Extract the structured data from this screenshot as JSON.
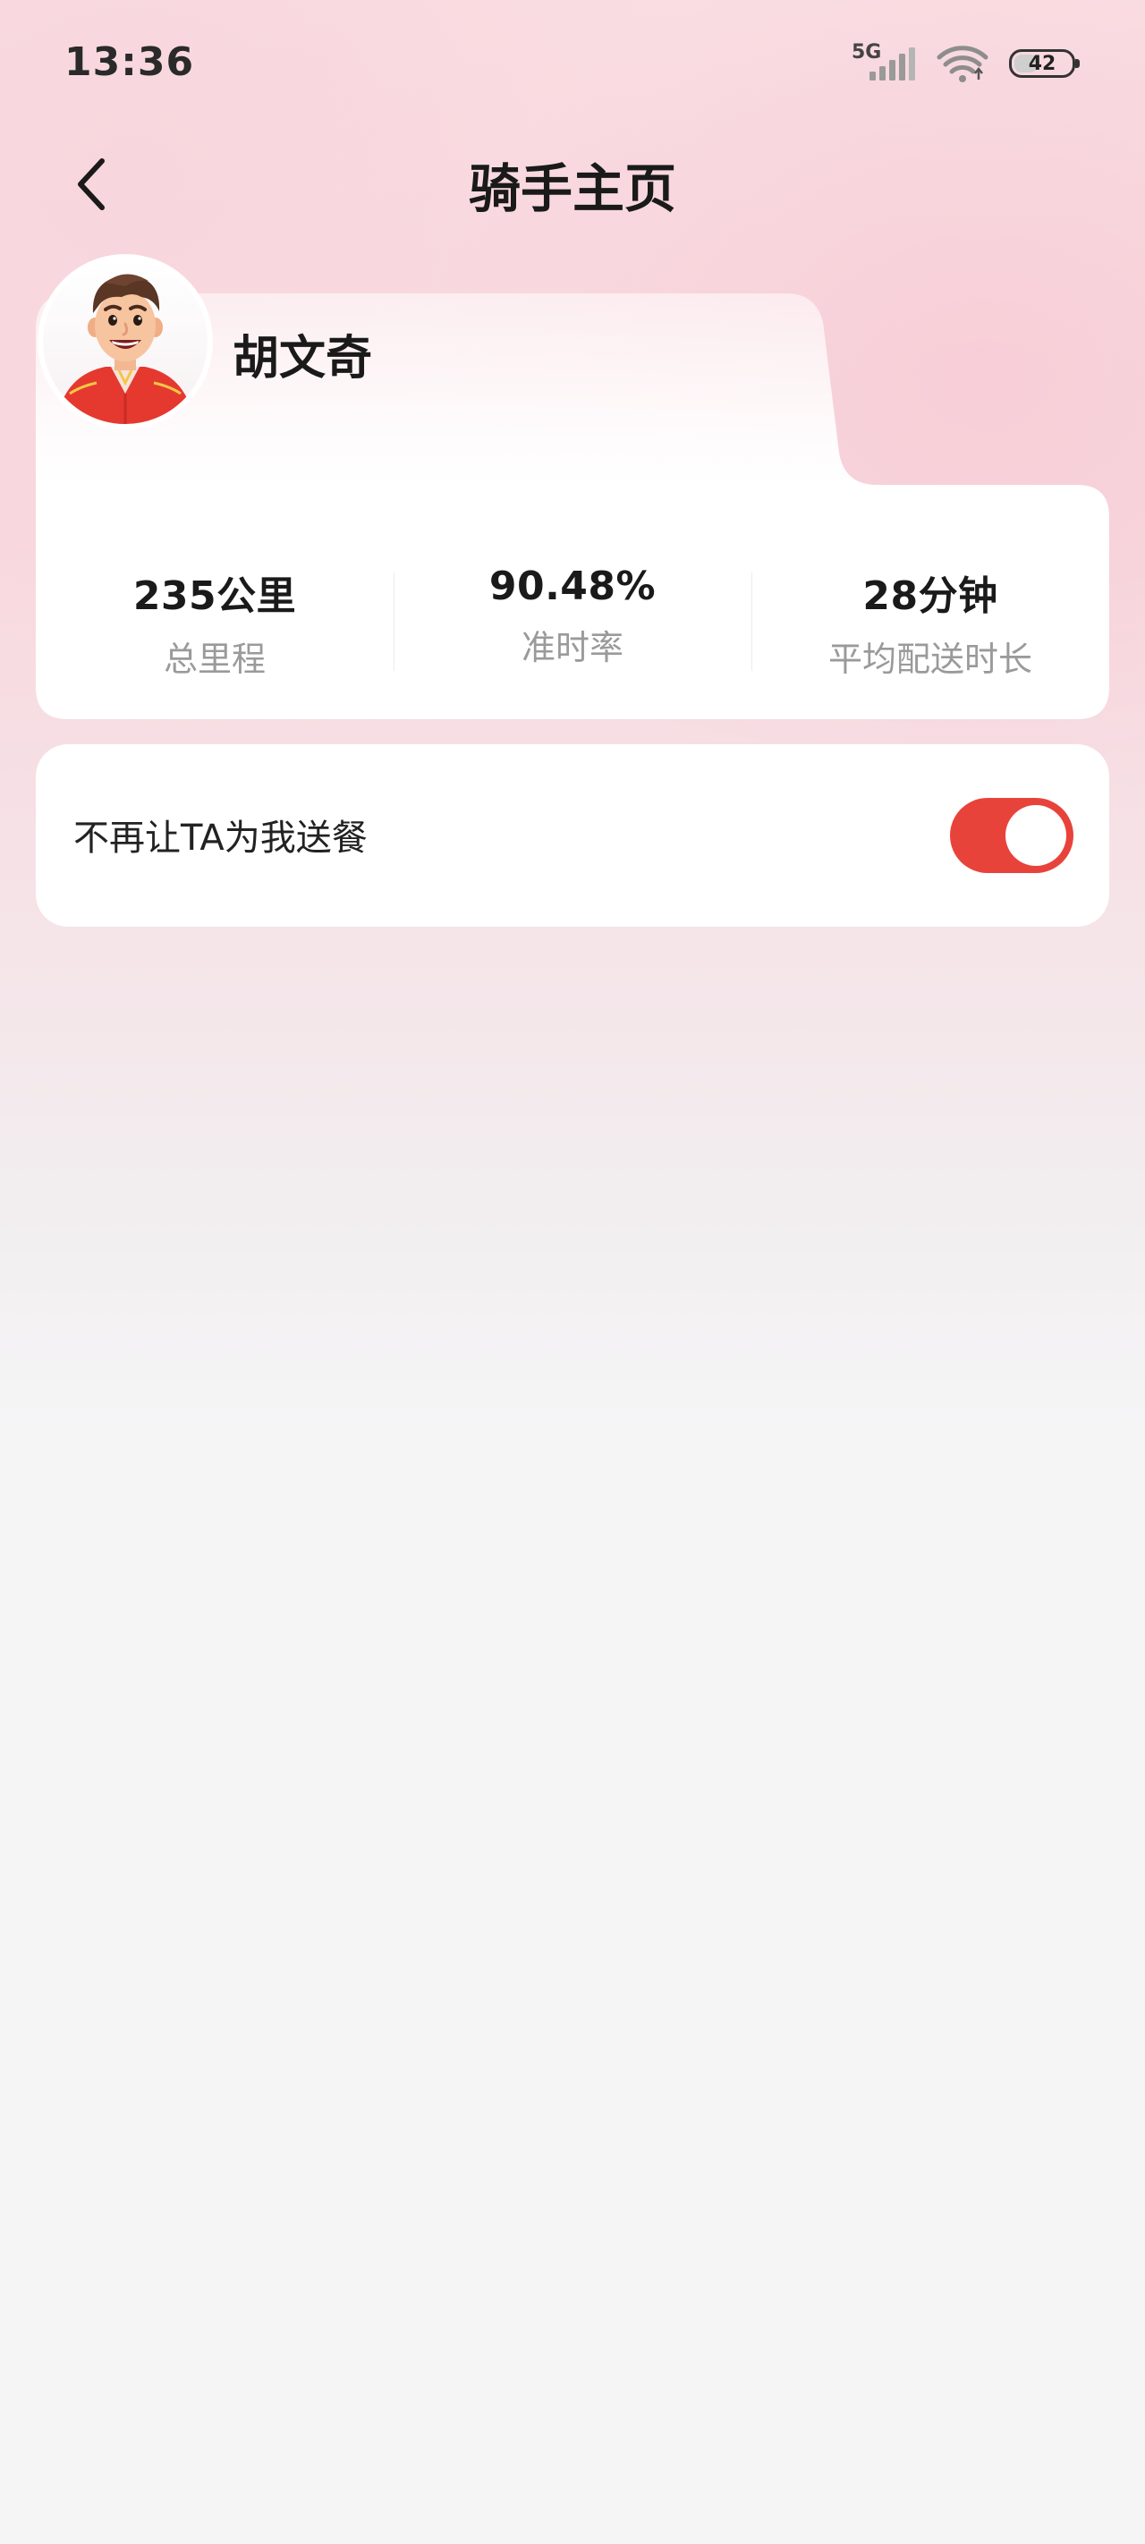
{
  "status_bar": {
    "time": "13:36",
    "network": "5G",
    "battery": "42",
    "battery_level": 0.42
  },
  "header": {
    "title": "骑手主页",
    "back_icon": "chevron-left-icon"
  },
  "rider": {
    "name": "胡文奇",
    "avatar_icon": "rider-avatar",
    "stats": [
      {
        "value": "235公里",
        "label": "总里程"
      },
      {
        "value": "90.48%",
        "label": "准时率"
      },
      {
        "value": "28分钟",
        "label": "平均配送时长"
      }
    ]
  },
  "settings": {
    "block_rider_label": "不再让TA为我送餐",
    "block_rider_enabled": true
  },
  "colors": {
    "accent": "#e8433a",
    "background_top": "#f9dde2",
    "background_bottom": "#f5f5f6",
    "card": "#ffffff",
    "muted_text": "#9a9a9a"
  }
}
